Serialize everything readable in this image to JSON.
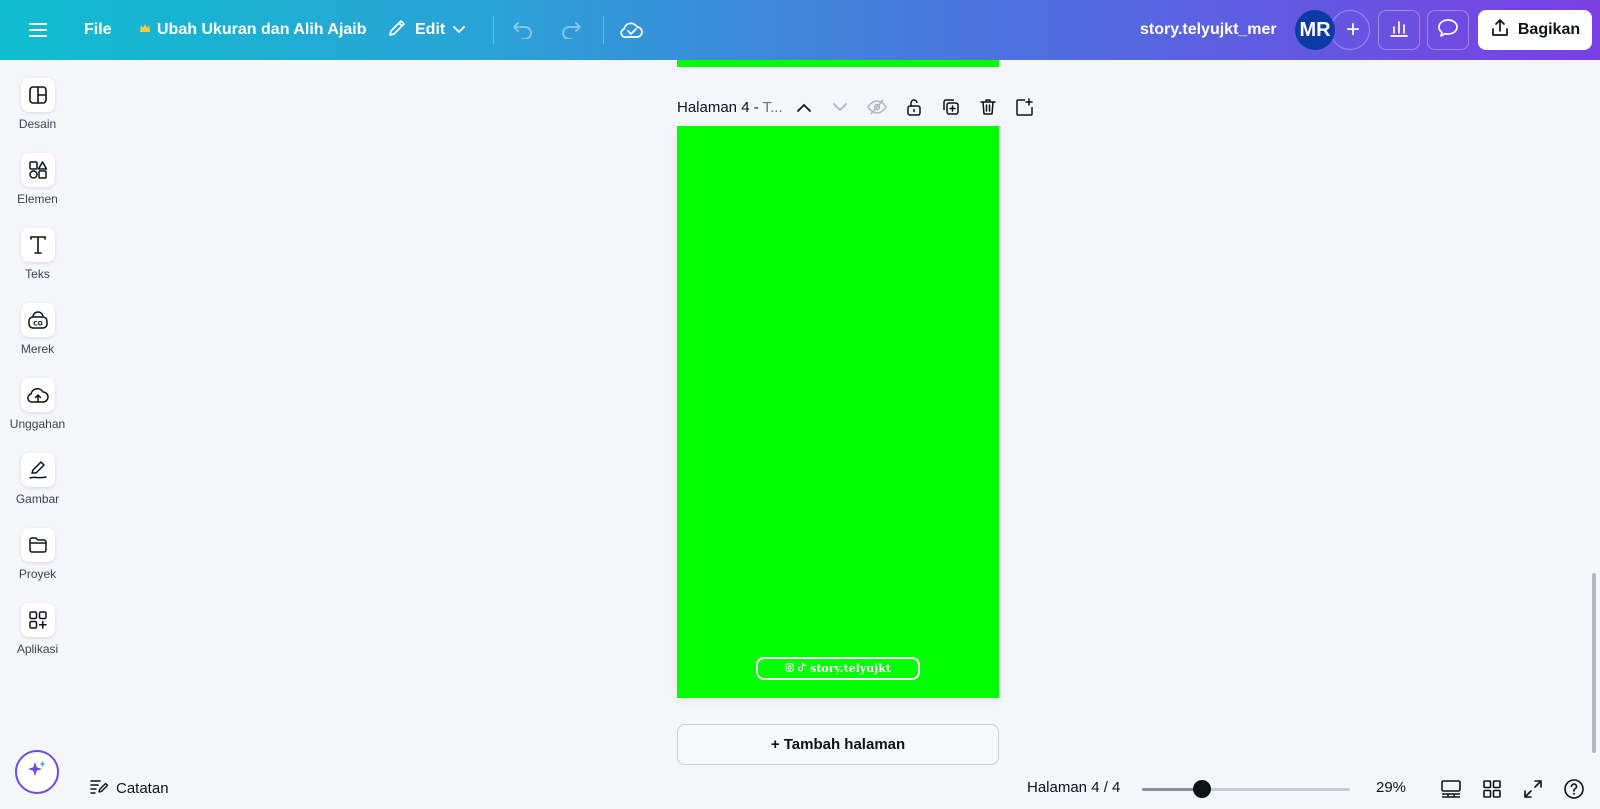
{
  "topbar": {
    "file_label": "File",
    "magic_resize_label": "Ubah Ukuran dan Alih Ajaib",
    "edit_label": "Edit",
    "doc_title": "story.telyujkt_mer",
    "avatar_initials": "MR",
    "share_label": "Bagikan"
  },
  "sidebar": {
    "items": [
      {
        "label": "Desain",
        "icon": "layout-icon"
      },
      {
        "label": "Elemen",
        "icon": "elements-icon"
      },
      {
        "label": "Teks",
        "icon": "text-icon"
      },
      {
        "label": "Merek",
        "icon": "brand-icon"
      },
      {
        "label": "Unggahan",
        "icon": "upload-cloud-icon"
      },
      {
        "label": "Gambar",
        "icon": "draw-icon"
      },
      {
        "label": "Proyek",
        "icon": "folder-icon"
      },
      {
        "label": "Aplikasi",
        "icon": "apps-icon"
      }
    ]
  },
  "canvas": {
    "page_title": "Halaman 4 - ",
    "page_title_rest": "T...",
    "page_background": "#00ff00",
    "watermark_text": "story.telyujkt",
    "add_page_label": "+ Tambah halaman"
  },
  "bottombar": {
    "notes_label": "Catatan",
    "page_indicator": "Halaman 4 / 4",
    "zoom_label": "29%",
    "zoom_fraction": 0.29
  },
  "colors": {
    "accent_purple": "#7b3fe4",
    "accent_teal": "#0fbdd0",
    "avatar_bg": "#0c3aa6"
  }
}
